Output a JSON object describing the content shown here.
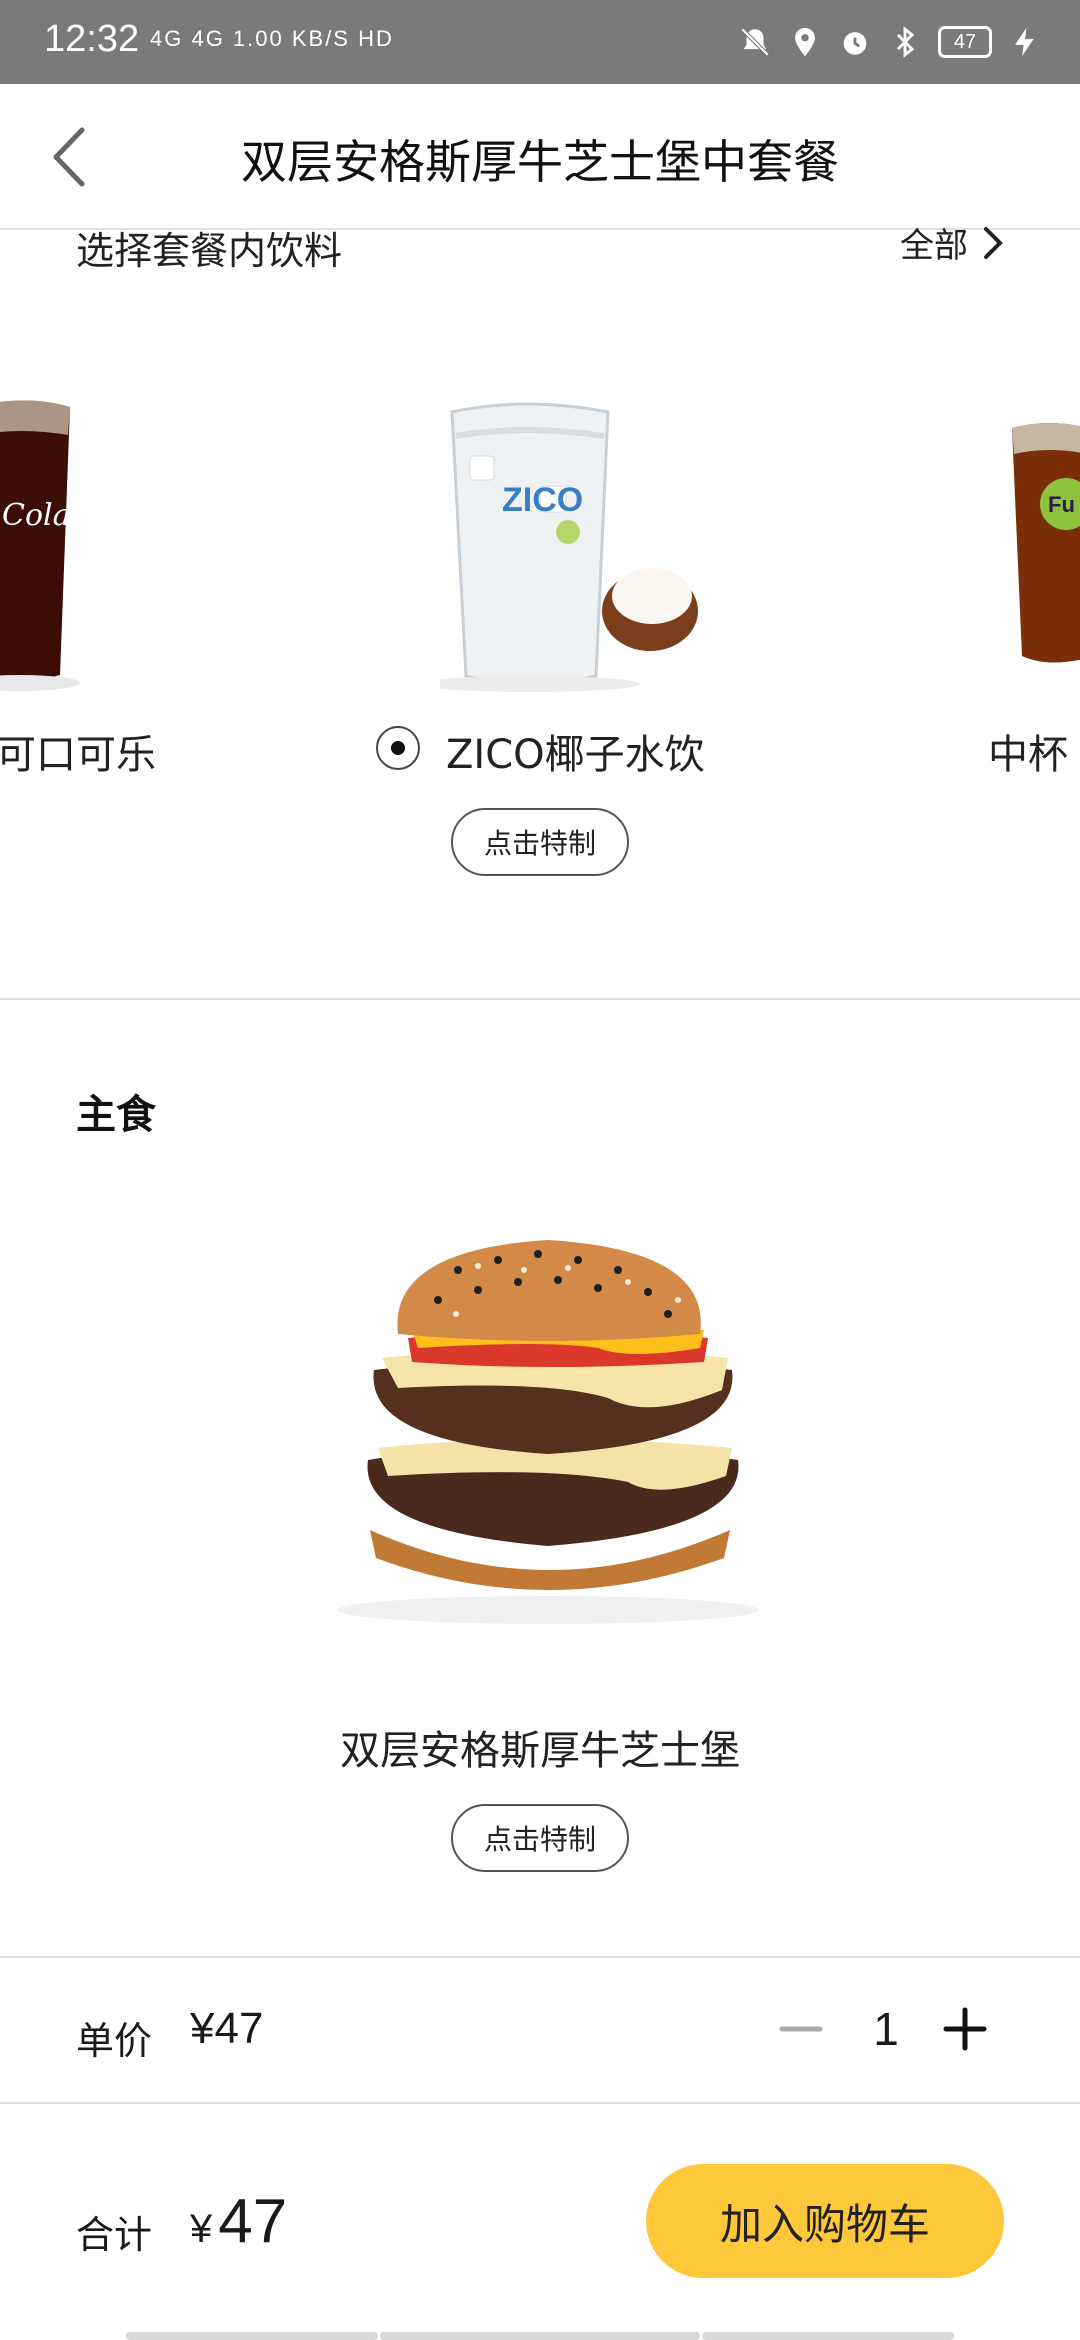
{
  "status_bar": {
    "time": "12:32",
    "network": "4G  4G  1.00 KB/S  HD",
    "battery": "47"
  },
  "header": {
    "title": "双层安格斯厚牛芝士堡中套餐"
  },
  "drinks": {
    "heading": "选择套餐内饮料",
    "all_link": "全部",
    "items": [
      {
        "label": "可口可乐"
      },
      {
        "label": "ZICO椰子水饮",
        "selected": true
      },
      {
        "label": "中杯"
      }
    ],
    "custom_button": "点击特制"
  },
  "main_course": {
    "heading": "主食",
    "item_name": "双层安格斯厚牛芝士堡",
    "custom_button": "点击特制"
  },
  "price_row": {
    "unit_label": "单价",
    "unit_price": "¥47",
    "quantity": "1"
  },
  "footer": {
    "total_label": "合计",
    "currency": "¥",
    "total_value": "47",
    "cart_button": "加入购物车"
  },
  "colors": {
    "accent": "#ffc83a",
    "status_bar": "#7a7a7a"
  }
}
